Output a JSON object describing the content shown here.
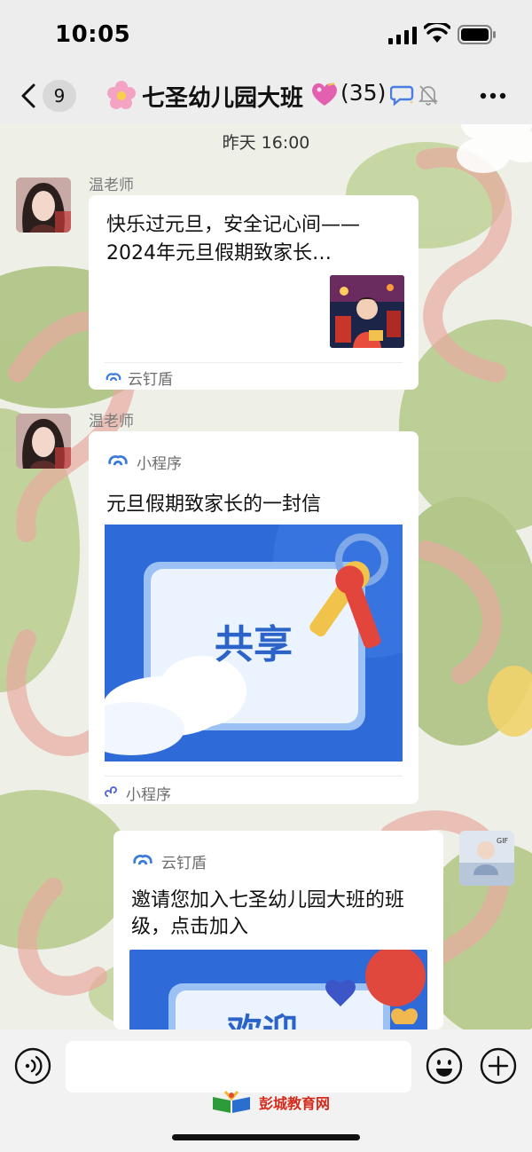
{
  "status_bar": {
    "time": "10:05"
  },
  "nav": {
    "unread_count": "9",
    "title": "七圣幼儿园大班",
    "member_count": "(35)",
    "icons": [
      "back-icon",
      "flower-icon",
      "heart-icon",
      "ai-chat-icon",
      "mute-icon",
      "more-icon"
    ]
  },
  "chat": {
    "timestamp": "昨天 16:00",
    "messages": [
      {
        "sender": "温老师",
        "title": "快乐过元旦，安全记心间——2024年元旦假期致家长…",
        "source": "云钉盾"
      },
      {
        "sender": "温老师",
        "header": "小程序",
        "title": "元旦假期致家长的一封信",
        "image_text": "共享",
        "footer": "小程序"
      },
      {
        "header": "云钉盾",
        "title": "邀请您加入七圣幼儿园大班的班级，点击加入",
        "image_text": "欢迎"
      }
    ]
  },
  "input_bar": {
    "placeholder": ""
  },
  "watermark": {
    "text": "彭城教育网"
  },
  "colors": {
    "nav_bg": "#ededed",
    "card_bg": "#ffffff",
    "accent_blue": "#2f6bd8",
    "watermark_red": "#d62a1b"
  }
}
